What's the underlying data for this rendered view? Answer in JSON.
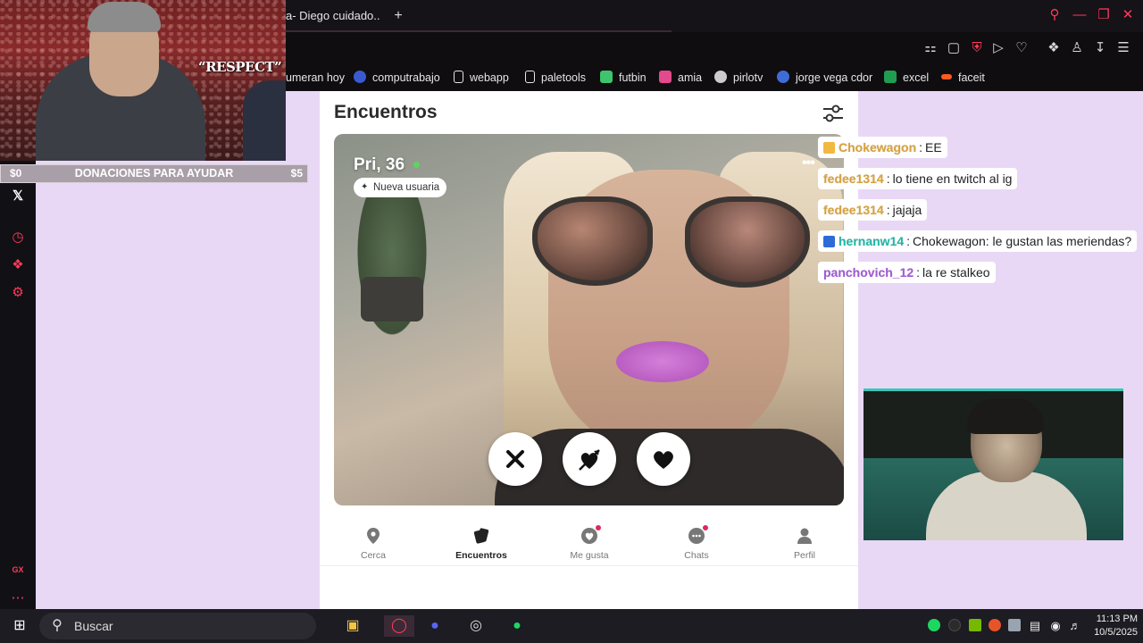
{
  "browser": {
    "tab_title": "a- Diego cuidado..",
    "new_tab": "+",
    "bookmarks": [
      {
        "label": "umeran hoy",
        "color": "#0f0d10"
      },
      {
        "label": "computrabajo",
        "color": "#3a5bd0"
      },
      {
        "label": "webapp",
        "color": "#e6e6e6"
      },
      {
        "label": "paletools",
        "color": "#e6e6e6"
      },
      {
        "label": "futbin",
        "color": "#3ec46d"
      },
      {
        "label": "amia",
        "color": "#e24a8b"
      },
      {
        "label": "pirlotv",
        "color": "#cccccc"
      },
      {
        "label": "jorge vega cdor",
        "color": "#3f6cd8"
      },
      {
        "label": "excel",
        "color": "#1f9e52"
      },
      {
        "label": "faceit",
        "color": "#ff5a1f"
      }
    ]
  },
  "overlay": {
    "quote": "“RESPECT”",
    "donation": {
      "left": "$0",
      "label": "DONACIONES PARA AYUDAR",
      "right": "$5"
    }
  },
  "page": {
    "title": "Encuentros",
    "profile": {
      "name": "Pri, 36",
      "badge": "Nueva usuaria"
    },
    "nav": [
      {
        "label": "Cerca",
        "icon": "location-pin-icon"
      },
      {
        "label": "Encuentros",
        "icon": "cards-icon"
      },
      {
        "label": "Me gusta",
        "icon": "heart-bubble-icon"
      },
      {
        "label": "Chats",
        "icon": "chat-bubble-icon"
      },
      {
        "label": "Perfil",
        "icon": "person-icon"
      }
    ]
  },
  "chat": [
    {
      "user": "Chokewagon",
      "color": "#d9a23b",
      "text": "EE"
    },
    {
      "user": "fedee1314",
      "color": "#d9a23b",
      "text": "lo tiene en twitch al ig"
    },
    {
      "user": "fedee1314",
      "color": "#d9a23b",
      "text": "jajaja"
    },
    {
      "user": "hernanw14",
      "color": "#20b8a8",
      "text": "Chokewagon: le gustan las meriendas?"
    },
    {
      "user": "panchovich_12",
      "color": "#a05ad8",
      "text": "la re stalkeo"
    }
  ],
  "taskbar": {
    "search_label": "Buscar",
    "time": "11:13 PM",
    "date": "10/5/2025"
  },
  "colors": {
    "accent": "#ff3b5c",
    "chat_bg": "#e8d8f5"
  }
}
